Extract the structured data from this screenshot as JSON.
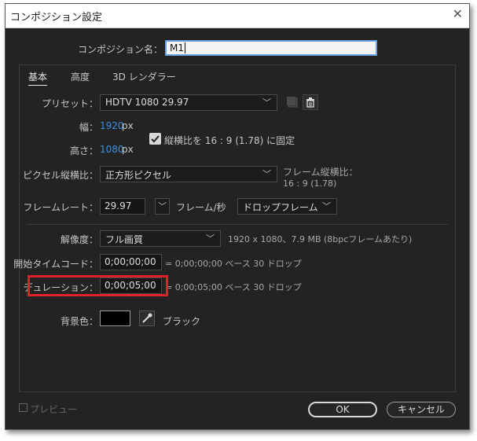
{
  "window": {
    "title": "コンポジション設定",
    "close_glyph": "✕"
  },
  "comp_name": {
    "label": "コンポジション名：",
    "value": "M1"
  },
  "tabs": [
    {
      "label": "基本"
    },
    {
      "label": "高度"
    },
    {
      "label": "3D レンダラー"
    }
  ],
  "preset": {
    "label": "プリセット：",
    "value": "HDTV 1080 29.97"
  },
  "width": {
    "label": "幅：",
    "value": "1920",
    "unit": "px"
  },
  "height": {
    "label": "高さ：",
    "value": "1080",
    "unit": "px"
  },
  "lock_aspect": {
    "label": "縦横比を 16 : 9 (1.78) に固定",
    "checked": true
  },
  "pixel_aspect": {
    "label": "ピクセル縦横比：",
    "value": "正方形ピクセル"
  },
  "frame_aspect": {
    "label": "フレーム縦横比：",
    "value": "16 : 9 (1.78)"
  },
  "frame_rate": {
    "label": "フレームレート：",
    "value": "29.97",
    "unit": "フレーム/秒",
    "mode": "ドロップフレーム"
  },
  "resolution": {
    "label": "解像度：",
    "value": "フル画質",
    "info": "1920 x 1080、7.9 MB (8bpcフレームあたり)"
  },
  "start_timecode": {
    "label": "開始タイムコード：",
    "value": "0;00;00;00",
    "info": "= 0;00;00;00  ベース 30  ドロップ"
  },
  "duration": {
    "label": "デュレーション：",
    "value": "0;00;05;00",
    "info": "= 0;00;05;00  ベース 30  ドロップ"
  },
  "background": {
    "label": "背景色：",
    "color_name": "ブラック",
    "swatch_color": "#000000"
  },
  "footer": {
    "preview_label": "プレビュー",
    "ok_label": "OK",
    "cancel_label": "キャンセル"
  },
  "colors": {
    "accent": "#3d8fe0",
    "highlight": "#e0202a",
    "bg": "#232323"
  }
}
